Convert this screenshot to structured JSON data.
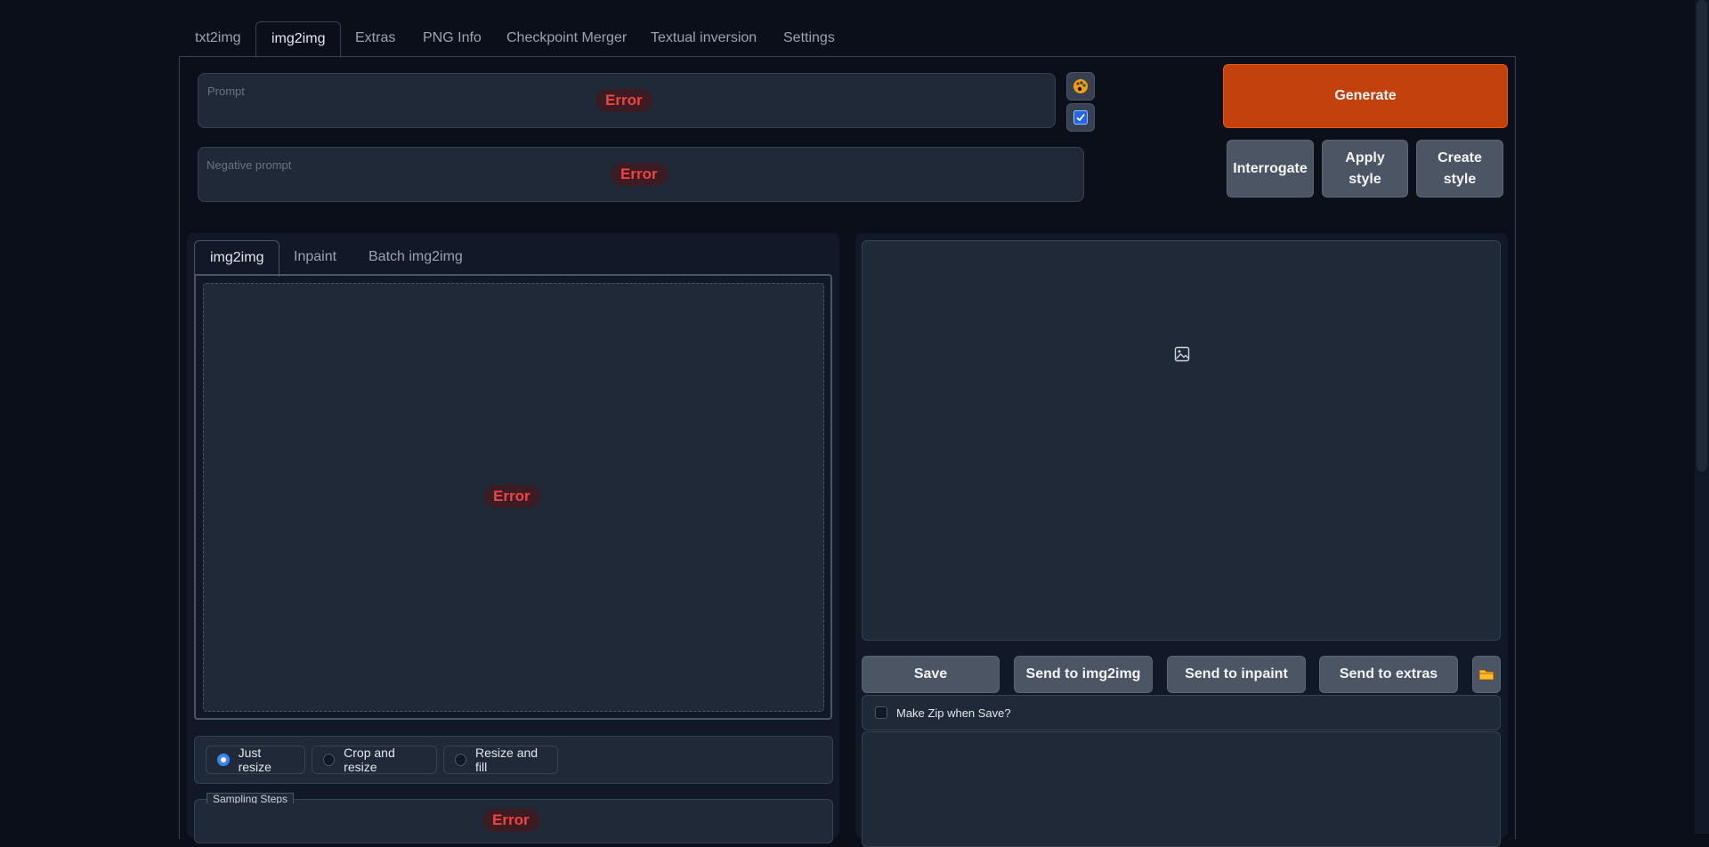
{
  "tabs": [
    "txt2img",
    "img2img",
    "Extras",
    "PNG Info",
    "Checkpoint Merger",
    "Textual inversion",
    "Settings"
  ],
  "prompt": {
    "label": "Prompt",
    "error": "Error"
  },
  "negative_prompt": {
    "label": "Negative prompt",
    "error": "Error"
  },
  "buttons": {
    "generate": "Generate",
    "interrogate": "Interrogate",
    "apply_style_1": "Apply",
    "apply_style_2": "style",
    "create_style_1": "Create",
    "create_style_2": "style"
  },
  "img2img_tabs": [
    "img2img",
    "Inpaint",
    "Batch img2img"
  ],
  "image_error": "Error",
  "resize_modes": [
    "Just resize",
    "Crop and resize",
    "Resize and fill"
  ],
  "sampling_steps": {
    "label": "Sampling Steps",
    "error": "Error"
  },
  "output_actions": [
    "Save",
    "Send to img2img",
    "Send to inpaint",
    "Send to extras"
  ],
  "make_zip_label": "Make Zip when Save?",
  "icons": {
    "style": "palette-icon",
    "check": "checkbox-icon",
    "folder": "folder-icon",
    "image": "image-placeholder-icon"
  },
  "colors": {
    "background": "#0b0f19",
    "generate": "#c2410c",
    "panel": "#1f2937",
    "error": "#ef4444"
  }
}
